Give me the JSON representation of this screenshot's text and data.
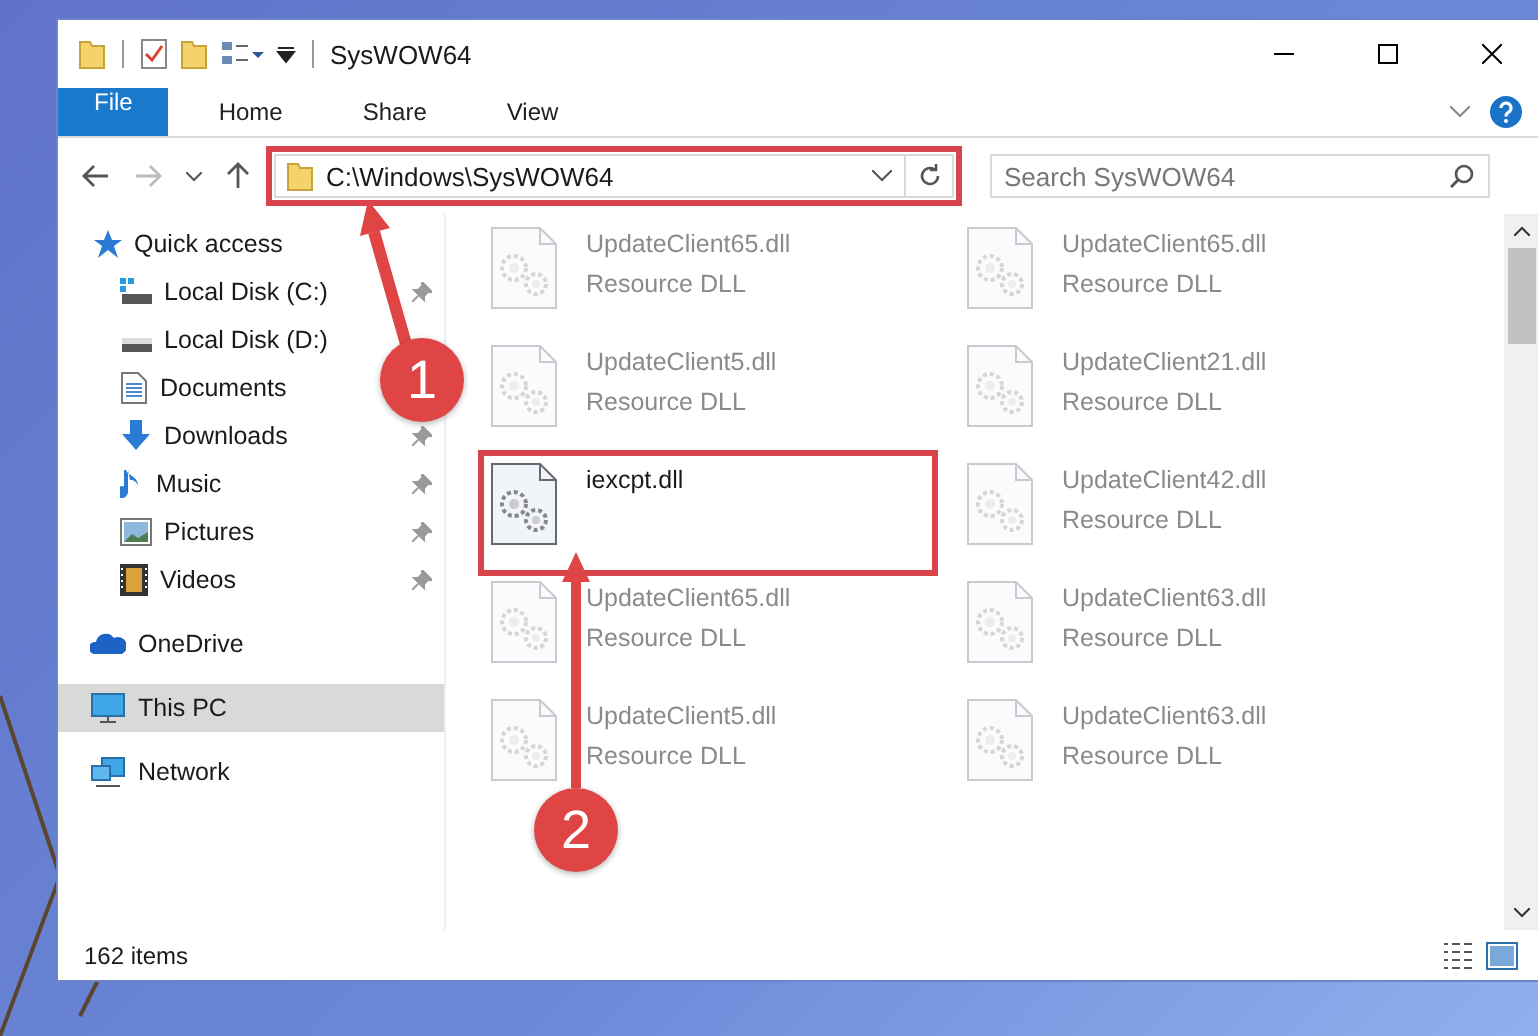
{
  "window": {
    "title": "SysWOW64"
  },
  "ribbon_tabs": [
    {
      "label": "File",
      "kind": "file"
    },
    {
      "label": "Home",
      "kind": "tab"
    },
    {
      "label": "Share",
      "kind": "tab"
    },
    {
      "label": "View",
      "kind": "tab"
    }
  ],
  "address_bar": {
    "path": "C:\\Windows\\SysWOW64"
  },
  "search": {
    "placeholder": "Search SysWOW64"
  },
  "sidebar": {
    "items": [
      {
        "label": "Quick access",
        "kind": "star",
        "selected": false,
        "children": [
          {
            "label": "Local Disk (C:)",
            "kind": "system-drive",
            "pinned": true
          },
          {
            "label": "Local Disk (D:)",
            "kind": "drive",
            "pinned": false
          },
          {
            "label": "Documents",
            "kind": "documents",
            "pinned": false
          },
          {
            "label": "Downloads",
            "kind": "downloads",
            "pinned": true
          },
          {
            "label": "Music",
            "kind": "music",
            "pinned": true
          },
          {
            "label": "Pictures",
            "kind": "pictures",
            "pinned": true
          },
          {
            "label": "Videos",
            "kind": "videos",
            "pinned": true
          }
        ]
      },
      {
        "label": "OneDrive",
        "kind": "cloud",
        "selected": false
      },
      {
        "label": "This PC",
        "kind": "pc",
        "selected": true
      },
      {
        "label": "Network",
        "kind": "network",
        "selected": false
      }
    ]
  },
  "files": [
    {
      "name": "UpdateClient65.dll",
      "type": "Resource DLL",
      "faded": true,
      "highlighted": false
    },
    {
      "name": "UpdateClient65.dll",
      "type": "Resource DLL",
      "faded": true,
      "highlighted": false
    },
    {
      "name": "UpdateClient5.dll",
      "type": "Resource DLL",
      "faded": true,
      "highlighted": false
    },
    {
      "name": "UpdateClient21.dll",
      "type": "Resource DLL",
      "faded": true,
      "highlighted": false
    },
    {
      "name": "iexcpt.dll",
      "faded": false,
      "highlighted": true
    },
    {
      "name": "UpdateClient42.dll",
      "type": "Resource DLL",
      "faded": true,
      "highlighted": false
    },
    {
      "name": "UpdateClient65.dll",
      "type": "Resource DLL",
      "faded": true,
      "highlighted": false
    },
    {
      "name": "UpdateClient63.dll",
      "type": "Resource DLL",
      "faded": true,
      "highlighted": false
    },
    {
      "name": "UpdateClient5.dll",
      "type": "Resource DLL",
      "faded": true,
      "highlighted": false
    },
    {
      "name": "UpdateClient63.dll",
      "type": "Resource DLL",
      "faded": true,
      "highlighted": false
    }
  ],
  "status_bar": {
    "item_count": "162 items"
  },
  "annotations": {
    "address_highlighted": true,
    "steps": [
      "1",
      "2"
    ]
  }
}
